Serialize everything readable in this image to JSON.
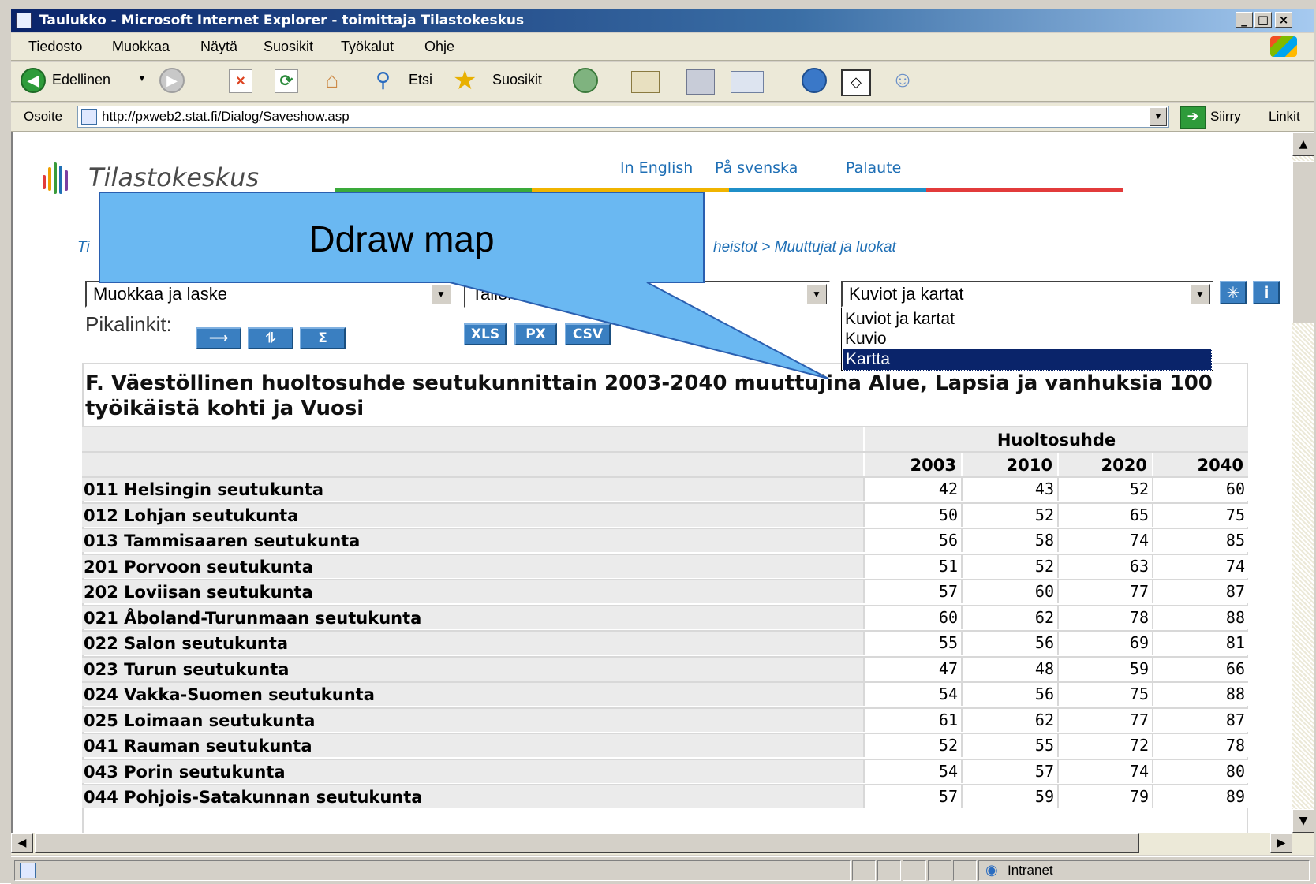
{
  "window": {
    "title": "Taulukko - Microsoft Internet Explorer - toimittaja Tilastokeskus",
    "min": "_",
    "max": "□",
    "close": "×"
  },
  "menu": [
    "Tiedosto",
    "Muokkaa",
    "Näytä",
    "Suosikit",
    "Työkalut",
    "Ohje"
  ],
  "toolbar": {
    "back": "Edellinen",
    "search": "Etsi",
    "favorites": "Suosikit"
  },
  "address": {
    "label": "Osoite",
    "url": "http://pxweb2.stat.fi/Dialog/Saveshow.asp",
    "go": "Siirry",
    "links": "Linkit"
  },
  "site": {
    "logo": "Tilastokeskus",
    "links": [
      "In English",
      "På svenska",
      "Palaute"
    ],
    "breadcrumb_start": "Ti",
    "breadcrumb_end": "heistot > Muuttujat ja luokat"
  },
  "controls": {
    "select1": "Muokkaa ja laske",
    "select2": "Tallenna",
    "select3": "Kuviot ja kartat",
    "quicklinks_label": "Pikalinkit:",
    "quick_icons": [
      "arrow-right-icon",
      "pivot-icon",
      "sum-icon"
    ],
    "quick_sum": "Σ",
    "save_buttons": [
      "XLS",
      "PX",
      "CSV"
    ],
    "info_buttons": [
      "✳",
      "i"
    ],
    "dropdown_options": [
      "Kuviot ja kartat",
      "Kuvio",
      "Kartta"
    ],
    "dropdown_selected": "Kartta"
  },
  "callout": {
    "text": "Ddraw map",
    "color": "#6ab8f2"
  },
  "table": {
    "title": "F. Väestöllinen huoltosuhde seutukunnittain 2003-2040 muuttujina Alue, Lapsia ja vanhuksia 100 työikäistä kohti ja Vuosi",
    "group_header": "Huoltosuhde",
    "years": [
      "2003",
      "2010",
      "2020",
      "2040"
    ],
    "rows": [
      {
        "label": "011 Helsingin seutukunta",
        "values": [
          "42",
          "43",
          "52",
          "60"
        ]
      },
      {
        "label": "012 Lohjan seutukunta",
        "values": [
          "50",
          "52",
          "65",
          "75"
        ]
      },
      {
        "label": "013 Tammisaaren seutukunta",
        "values": [
          "56",
          "58",
          "74",
          "85"
        ]
      },
      {
        "label": "201 Porvoon seutukunta",
        "values": [
          "51",
          "52",
          "63",
          "74"
        ]
      },
      {
        "label": "202 Loviisan seutukunta",
        "values": [
          "57",
          "60",
          "77",
          "87"
        ]
      },
      {
        "label": "021 Åboland-Turunmaan seutukunta",
        "values": [
          "60",
          "62",
          "78",
          "88"
        ]
      },
      {
        "label": "022 Salon seutukunta",
        "values": [
          "55",
          "56",
          "69",
          "81"
        ]
      },
      {
        "label": "023 Turun seutukunta",
        "values": [
          "47",
          "48",
          "59",
          "66"
        ]
      },
      {
        "label": "024 Vakka-Suomen seutukunta",
        "values": [
          "54",
          "56",
          "75",
          "88"
        ]
      },
      {
        "label": "025 Loimaan seutukunta",
        "values": [
          "61",
          "62",
          "77",
          "87"
        ]
      },
      {
        "label": "041 Rauman seutukunta",
        "values": [
          "52",
          "55",
          "72",
          "78"
        ]
      },
      {
        "label": "043 Porin seutukunta",
        "values": [
          "54",
          "57",
          "74",
          "80"
        ]
      },
      {
        "label": "044 Pohjois-Satakunnan seutukunta",
        "values": [
          "57",
          "59",
          "79",
          "89"
        ]
      }
    ]
  },
  "status": {
    "zone": "Intranet"
  }
}
